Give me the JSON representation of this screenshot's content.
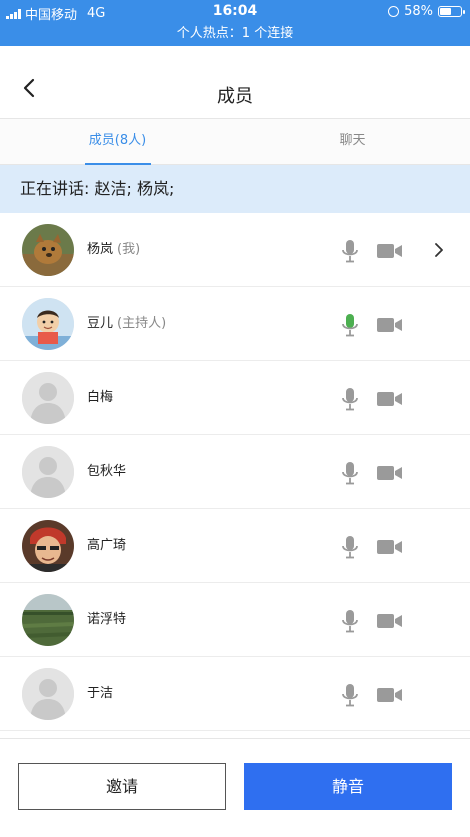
{
  "status_bar": {
    "carrier": "中国移动",
    "network": "4G",
    "time": "16:04",
    "battery_pct": "58%",
    "battery_level": 0.58,
    "hotspot": "个人热点：1 个连接"
  },
  "nav": {
    "title": "成员",
    "back_icon": "chevron-left-icon"
  },
  "tabs": [
    {
      "label": "成员(8人)",
      "active": true
    },
    {
      "label": "聊天",
      "active": false
    }
  ],
  "speaking": "正在讲话: 赵洁; 杨岚;",
  "members": [
    {
      "name": "杨岚",
      "role": "(我)",
      "avatar": "photo-dog",
      "mic_active": false,
      "has_chevron": true
    },
    {
      "name": "豆儿",
      "role": "(主持人)",
      "avatar": "photo-child",
      "mic_active": true,
      "has_chevron": false
    },
    {
      "name": "白梅",
      "role": "",
      "avatar": "default",
      "mic_active": false,
      "has_chevron": false
    },
    {
      "name": "包秋华",
      "role": "",
      "avatar": "default",
      "mic_active": false,
      "has_chevron": false
    },
    {
      "name": "高广琦",
      "role": "",
      "avatar": "photo-anime",
      "mic_active": false,
      "has_chevron": false
    },
    {
      "name": "诺浮特",
      "role": "",
      "avatar": "photo-field",
      "mic_active": false,
      "has_chevron": false
    },
    {
      "name": "于洁",
      "role": "",
      "avatar": "default",
      "mic_active": false,
      "has_chevron": false
    }
  ],
  "buttons": {
    "invite": "邀请",
    "mute": "静音"
  },
  "colors": {
    "accent": "#3a8ee8",
    "mute_button": "#2f6ff0",
    "mic_active": "#4caf50",
    "icon_gray": "#9a9a9a",
    "speaking_bg": "#dcebfa"
  }
}
